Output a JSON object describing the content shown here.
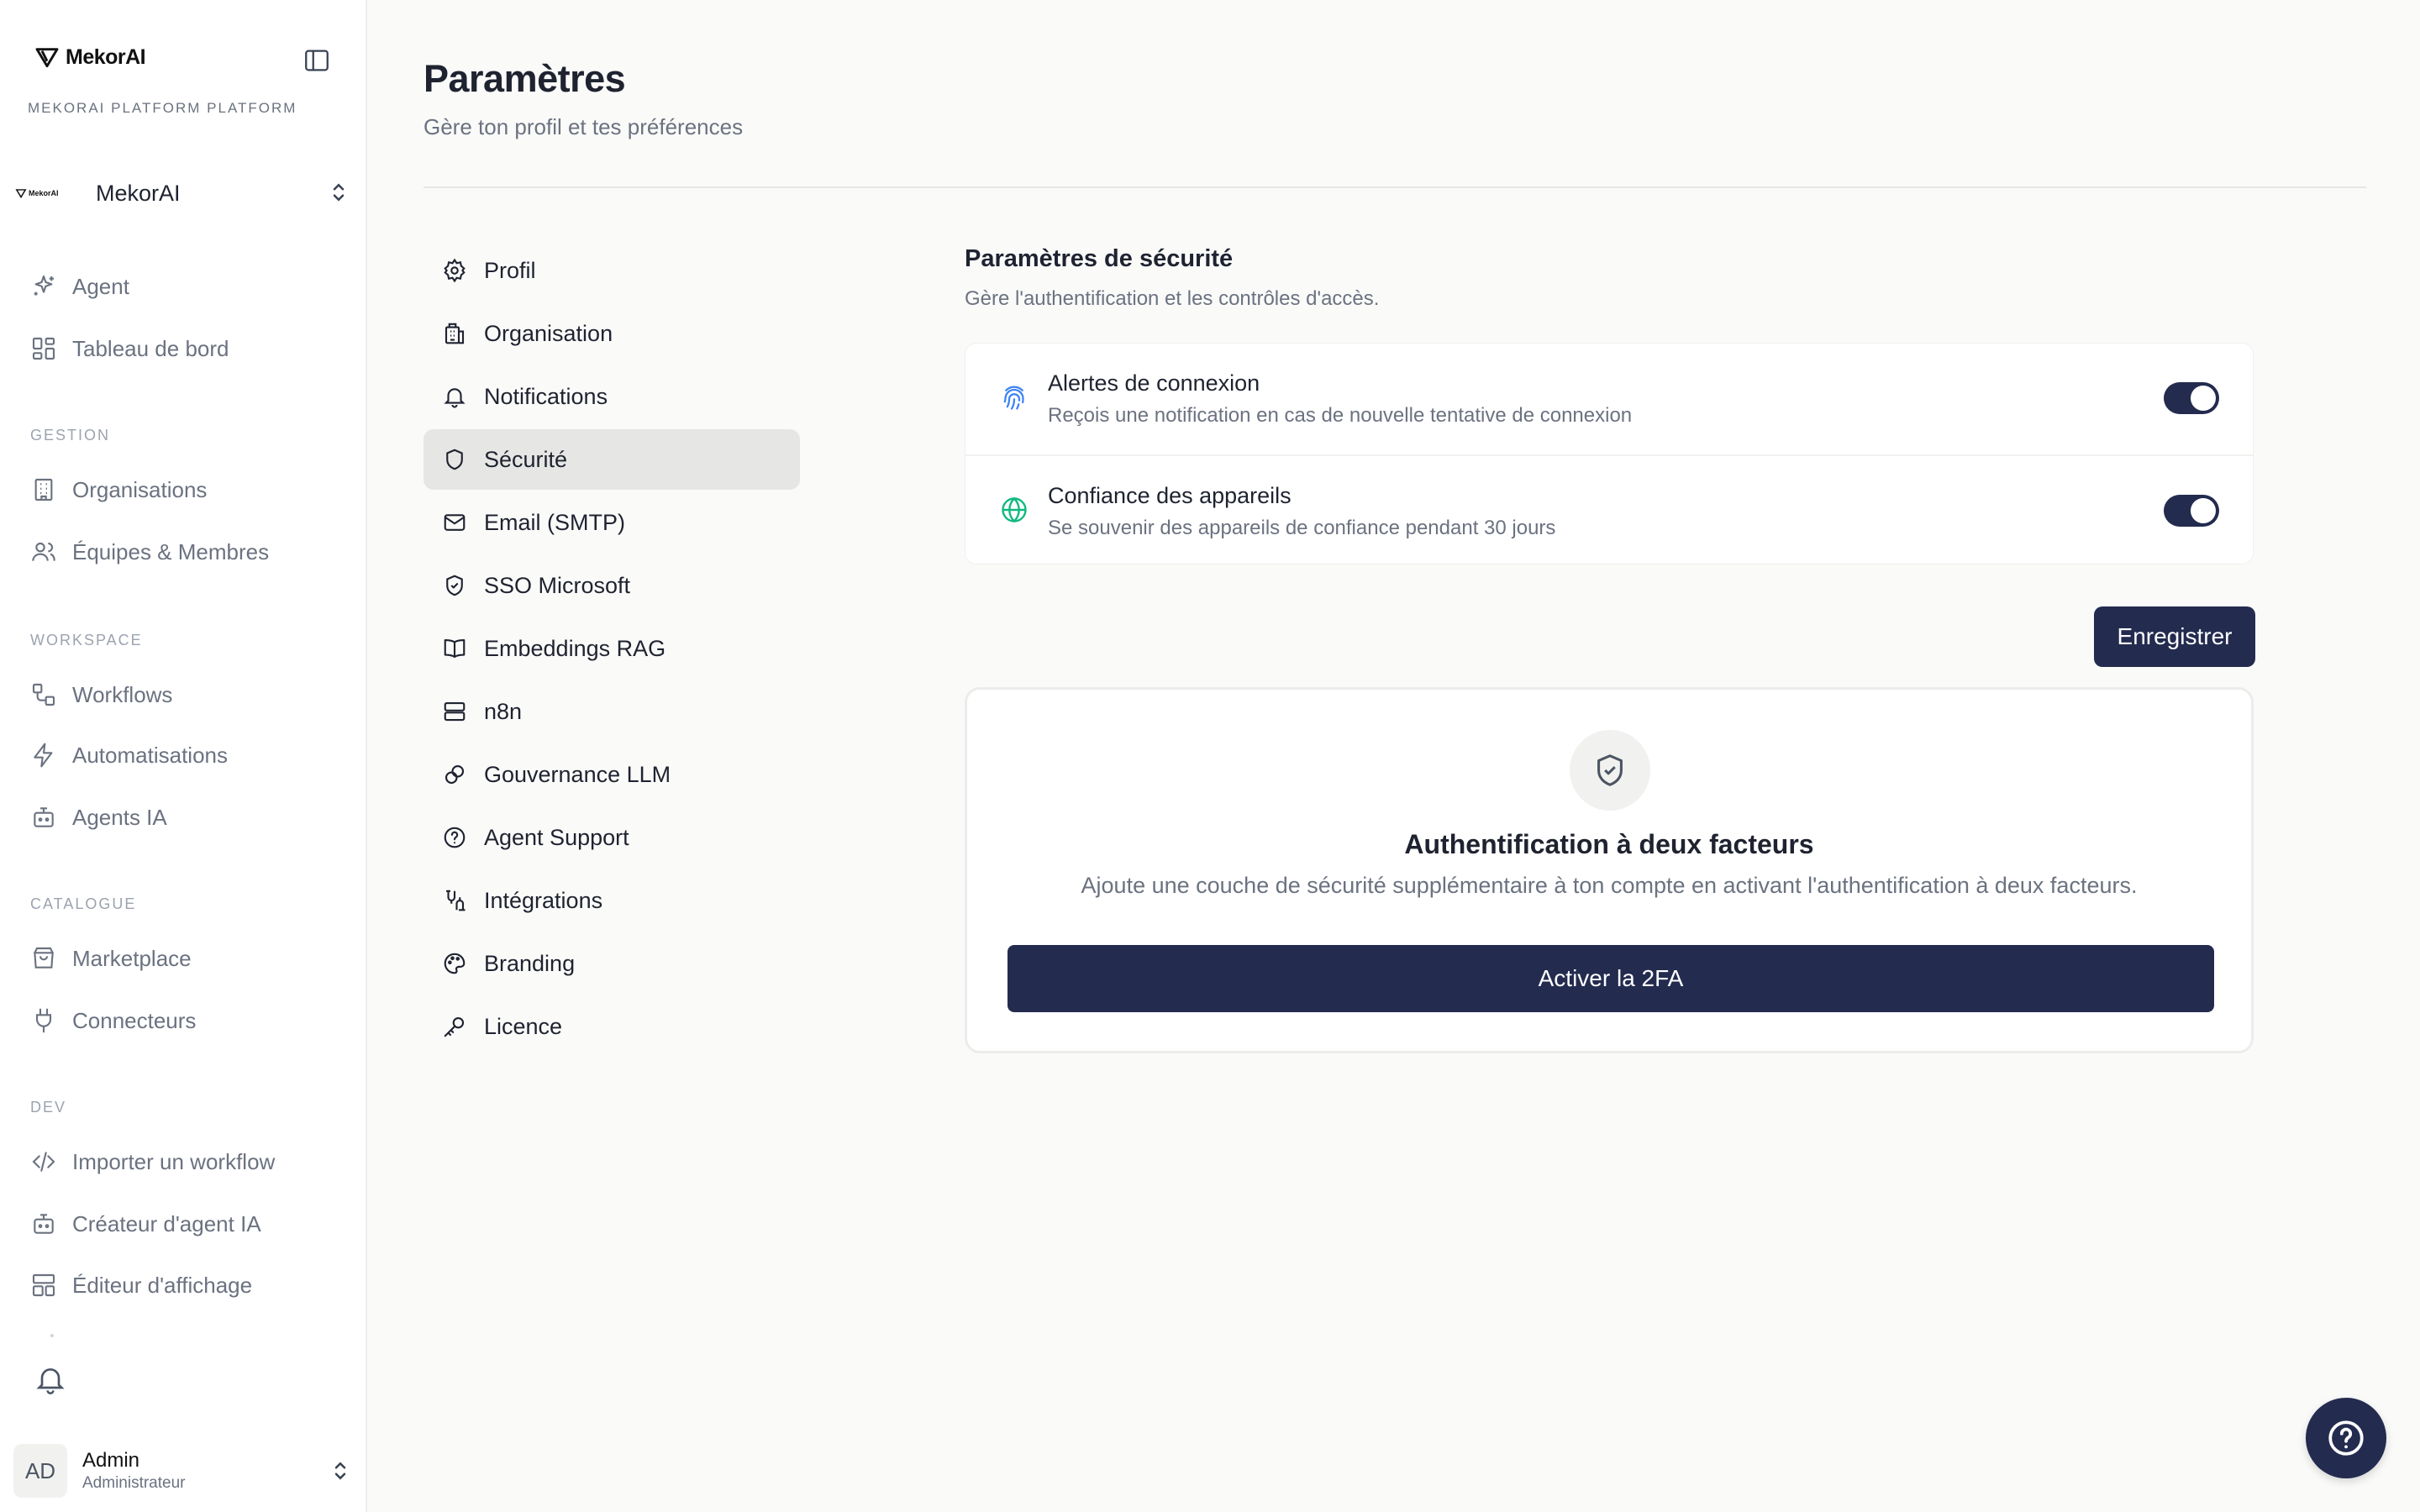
{
  "sidebar": {
    "brand": "MekorAI",
    "platform_label": "MEKORAI PLATFORM PLATFORM",
    "org_logo_text": "MekorAI",
    "org_name": "MekorAI",
    "items_top": [
      {
        "label": "Agent",
        "icon": "sparkles-icon"
      },
      {
        "label": "Tableau de bord",
        "icon": "dashboard-icon"
      }
    ],
    "sections": [
      {
        "title": "GESTION",
        "items": [
          {
            "label": "Organisations",
            "icon": "building-icon"
          },
          {
            "label": "Équipes & Membres",
            "icon": "users-icon"
          }
        ]
      },
      {
        "title": "WORKSPACE",
        "items": [
          {
            "label": "Workflows",
            "icon": "workflow-icon"
          },
          {
            "label": "Automatisations",
            "icon": "zap-icon"
          },
          {
            "label": "Agents IA",
            "icon": "bot-icon"
          }
        ]
      },
      {
        "title": "CATALOGUE",
        "items": [
          {
            "label": "Marketplace",
            "icon": "shopping-bag-icon"
          },
          {
            "label": "Connecteurs",
            "icon": "plug-icon"
          }
        ]
      },
      {
        "title": "DEV",
        "items": [
          {
            "label": "Importer un workflow",
            "icon": "code-icon"
          },
          {
            "label": "Créateur d'agent IA",
            "icon": "bot-icon"
          },
          {
            "label": "Éditeur d'affichage",
            "icon": "layout-icon"
          }
        ]
      }
    ],
    "user": {
      "initials": "AD",
      "name": "Admin",
      "role": "Administrateur"
    }
  },
  "header": {
    "title": "Paramètres",
    "subtitle": "Gère ton profil et tes préférences"
  },
  "settings_nav": [
    {
      "label": "Profil",
      "icon": "gear-icon"
    },
    {
      "label": "Organisation",
      "icon": "building-icon"
    },
    {
      "label": "Notifications",
      "icon": "bell-icon"
    },
    {
      "label": "Sécurité",
      "icon": "shield-icon",
      "active": true
    },
    {
      "label": "Email (SMTP)",
      "icon": "mail-icon"
    },
    {
      "label": "SSO Microsoft",
      "icon": "shield-check-icon"
    },
    {
      "label": "Embeddings RAG",
      "icon": "book-icon"
    },
    {
      "label": "n8n",
      "icon": "server-icon"
    },
    {
      "label": "Gouvernance LLM",
      "icon": "brain-icon"
    },
    {
      "label": "Agent Support",
      "icon": "help-circle-icon"
    },
    {
      "label": "Intégrations",
      "icon": "integrations-icon"
    },
    {
      "label": "Branding",
      "icon": "palette-icon"
    },
    {
      "label": "Licence",
      "icon": "key-icon"
    }
  ],
  "security": {
    "title": "Paramètres de sécurité",
    "subtitle": "Gère l'authentification et les contrôles d'accès.",
    "options": [
      {
        "title": "Alertes de connexion",
        "description": "Reçois une notification en cas de nouvelle tentative de connexion",
        "enabled": true,
        "icon": "fingerprint-icon",
        "icon_color": "#3b82f6"
      },
      {
        "title": "Confiance des appareils",
        "description": "Se souvenir des appareils de confiance pendant 30 jours",
        "enabled": true,
        "icon": "globe-icon",
        "icon_color": "#10b981"
      }
    ],
    "save_label": "Enregistrer"
  },
  "twofa": {
    "title": "Authentification à deux facteurs",
    "description": "Ajoute une couche de sécurité supplémentaire à ton compte en activant l'authentification à deux facteurs.",
    "button_label": "Activer la 2FA"
  },
  "colors": {
    "primary": "#232b4f",
    "background": "#fafaf9"
  }
}
